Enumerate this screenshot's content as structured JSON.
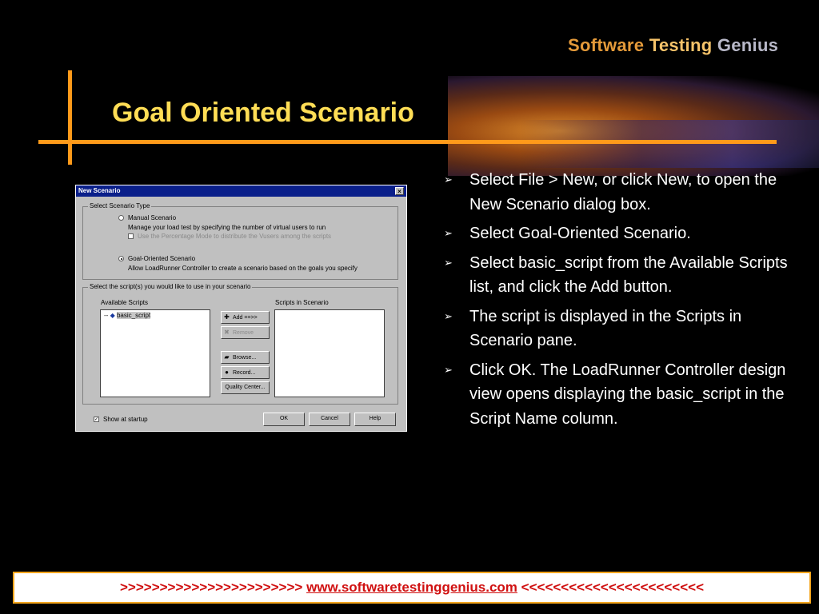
{
  "logo": {
    "part1": "Software ",
    "part2": "Testing",
    "part3": " Genius"
  },
  "title": "Goal Oriented Scenario",
  "dialog": {
    "title": "New Scenario",
    "close": "×",
    "scenario_type_group": "Select Scenario Type",
    "manual_label": "Manual Scenario",
    "manual_desc": "Manage your load test by specifying the number of virtual users to run",
    "percentage_check": "Use the Percentage Mode to distribute the Vusers among the scripts",
    "goal_label": "Goal-Oriented Scenario",
    "goal_desc": "Allow LoadRunner Controller to create a scenario based on the goals you specify",
    "scripts_group": "Select the script(s) you would like to use in your scenario",
    "available_label": "Available Scripts",
    "available_item": "basic_script",
    "tree_prefix": "--",
    "in_scenario_label": "Scripts in Scenario",
    "add_button": "Add ==>>",
    "remove_button": "Remove",
    "browse_button": "Browse...",
    "record_button": "Record...",
    "quality_button": "Quality Center...",
    "show_startup": "Show at startup",
    "ok": "OK",
    "cancel": "Cancel",
    "help": "Help"
  },
  "bullet_marker": "➢",
  "bullets": [
    "Select File > New, or click New, to open the New Scenario dialog box.",
    "Select Goal-Oriented Scenario.",
    "Select basic_script from the Available Scripts list, and click the Add button.",
    "The script is displayed in the Scripts in Scenario pane.",
    "Click OK. The LoadRunner Controller design view opens displaying the basic_script in the Script Name column."
  ],
  "footer": {
    "left": ">>>>>>>>>>>>>>>>>>>>>>>",
    "link": "www.softwaretestinggenius.com",
    "right": "<<<<<<<<<<<<<<<<<<<<<<<"
  },
  "colors": {
    "accent": "#ff9a1a",
    "title": "#ffdd55",
    "footer_text": "#d01010"
  }
}
